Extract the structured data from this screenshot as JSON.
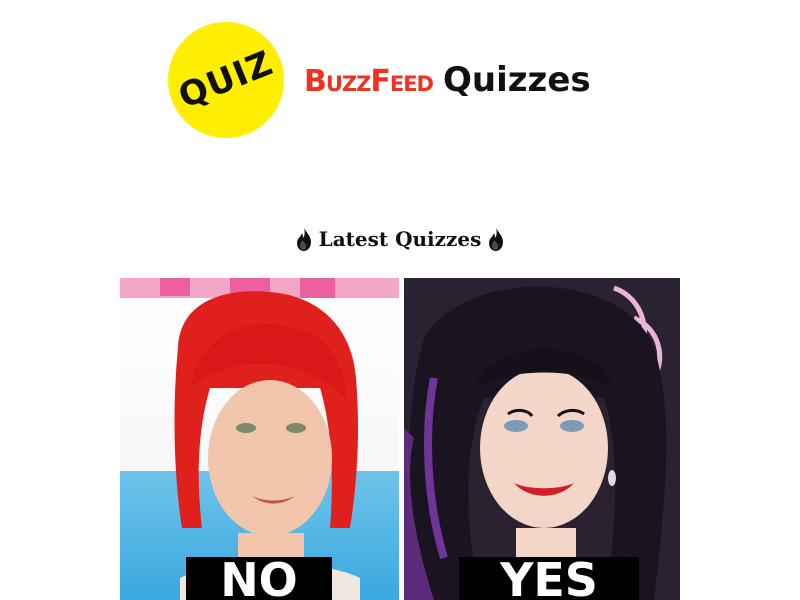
{
  "header": {
    "quiz_badge_text": "QUIZ",
    "brand_name": "BuzzFeed",
    "brand_suffix": "Quizzes"
  },
  "section": {
    "title": "Latest Quizzes",
    "icon_left": "flame-icon",
    "icon_right": "flame-icon"
  },
  "quiz_card": {
    "left_label": "NO",
    "right_label": "YES"
  },
  "colors": {
    "badge_yellow": "#FFEE00",
    "buzzfeed_red": "#EE3322",
    "text_dark": "#111111",
    "label_bg": "#000000"
  }
}
